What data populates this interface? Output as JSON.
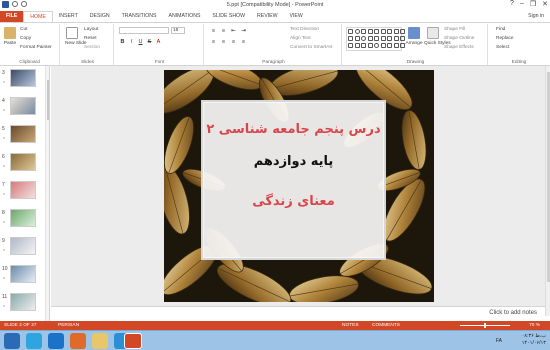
{
  "window": {
    "title": "5.ppt [Compatibility Mode] - PowerPoint",
    "controls": [
      "?",
      "–",
      "❐",
      "✕"
    ],
    "signin": "Sign in"
  },
  "tabs": [
    "FILE",
    "HOME",
    "INSERT",
    "DESIGN",
    "TRANSITIONS",
    "ANIMATIONS",
    "SLIDE SHOW",
    "REVIEW",
    "VIEW"
  ],
  "active_tab": "HOME",
  "ribbon": {
    "clipboard": {
      "label": "Clipboard",
      "paste": "Paste",
      "cut": "Cut",
      "copy": "Copy",
      "format_painter": "Format Painter"
    },
    "slides": {
      "label": "Slides",
      "new_slide": "New Slide",
      "layout": "Layout",
      "reset": "Reset",
      "section": "Section"
    },
    "font": {
      "label": "Font",
      "size": "18",
      "bold": "B",
      "italic": "I",
      "underline": "U",
      "strike": "S"
    },
    "paragraph": {
      "label": "Paragraph",
      "text_direction": "Text Direction",
      "align_text": "Align Text",
      "convert": "Convert to SmartArt"
    },
    "drawing": {
      "label": "Drawing",
      "arrange": "Arrange",
      "quick_styles": "Quick Styles",
      "shape_fill": "Shape Fill",
      "shape_outline": "Shape Outline",
      "shape_effects": "Shape Effects"
    },
    "editing": {
      "label": "Editing",
      "find": "Find",
      "replace": "Replace",
      "select": "Select"
    }
  },
  "thumbnails": [
    {
      "num": "3",
      "colors": [
        "#3a4a6a",
        "#b9c6da"
      ]
    },
    {
      "num": "4",
      "colors": [
        "#e6e0d4",
        "#7a8aa0"
      ]
    },
    {
      "num": "5",
      "colors": [
        "#6a4a2a",
        "#c8a878"
      ]
    },
    {
      "num": "6",
      "colors": [
        "#8a6a3a",
        "#e0c898"
      ]
    },
    {
      "num": "7",
      "colors": [
        "#d87a7a",
        "#f2e0e0"
      ]
    },
    {
      "num": "8",
      "colors": [
        "#6aa86a",
        "#dcefdc"
      ]
    },
    {
      "num": "9",
      "colors": [
        "#b0b8c8",
        "#f4f4f4"
      ]
    },
    {
      "num": "10",
      "colors": [
        "#6a8aaa",
        "#e8eef6"
      ]
    },
    {
      "num": "11",
      "colors": [
        "#8aa",
        "#eee"
      ]
    }
  ],
  "slide": {
    "line1": "درس پنجم جامعه شناسی ۲",
    "line2": "پایه دوازدهم",
    "line3": "معنای زندگی",
    "colors": {
      "accent": "#d8454a",
      "dark": "#111111"
    }
  },
  "notes_placeholder": "Click to add notes",
  "status": {
    "slide_info": "SLIDE 2 OF 27",
    "language": "PERSIAN",
    "notes": "NOTES",
    "comments": "COMMENTS",
    "zoom": "70 %"
  },
  "taskbar": {
    "time": "۰۸:۳۶ ب.ظ",
    "date": "۱۴۰۱/۰۶/۱۳",
    "lang": "FA"
  }
}
